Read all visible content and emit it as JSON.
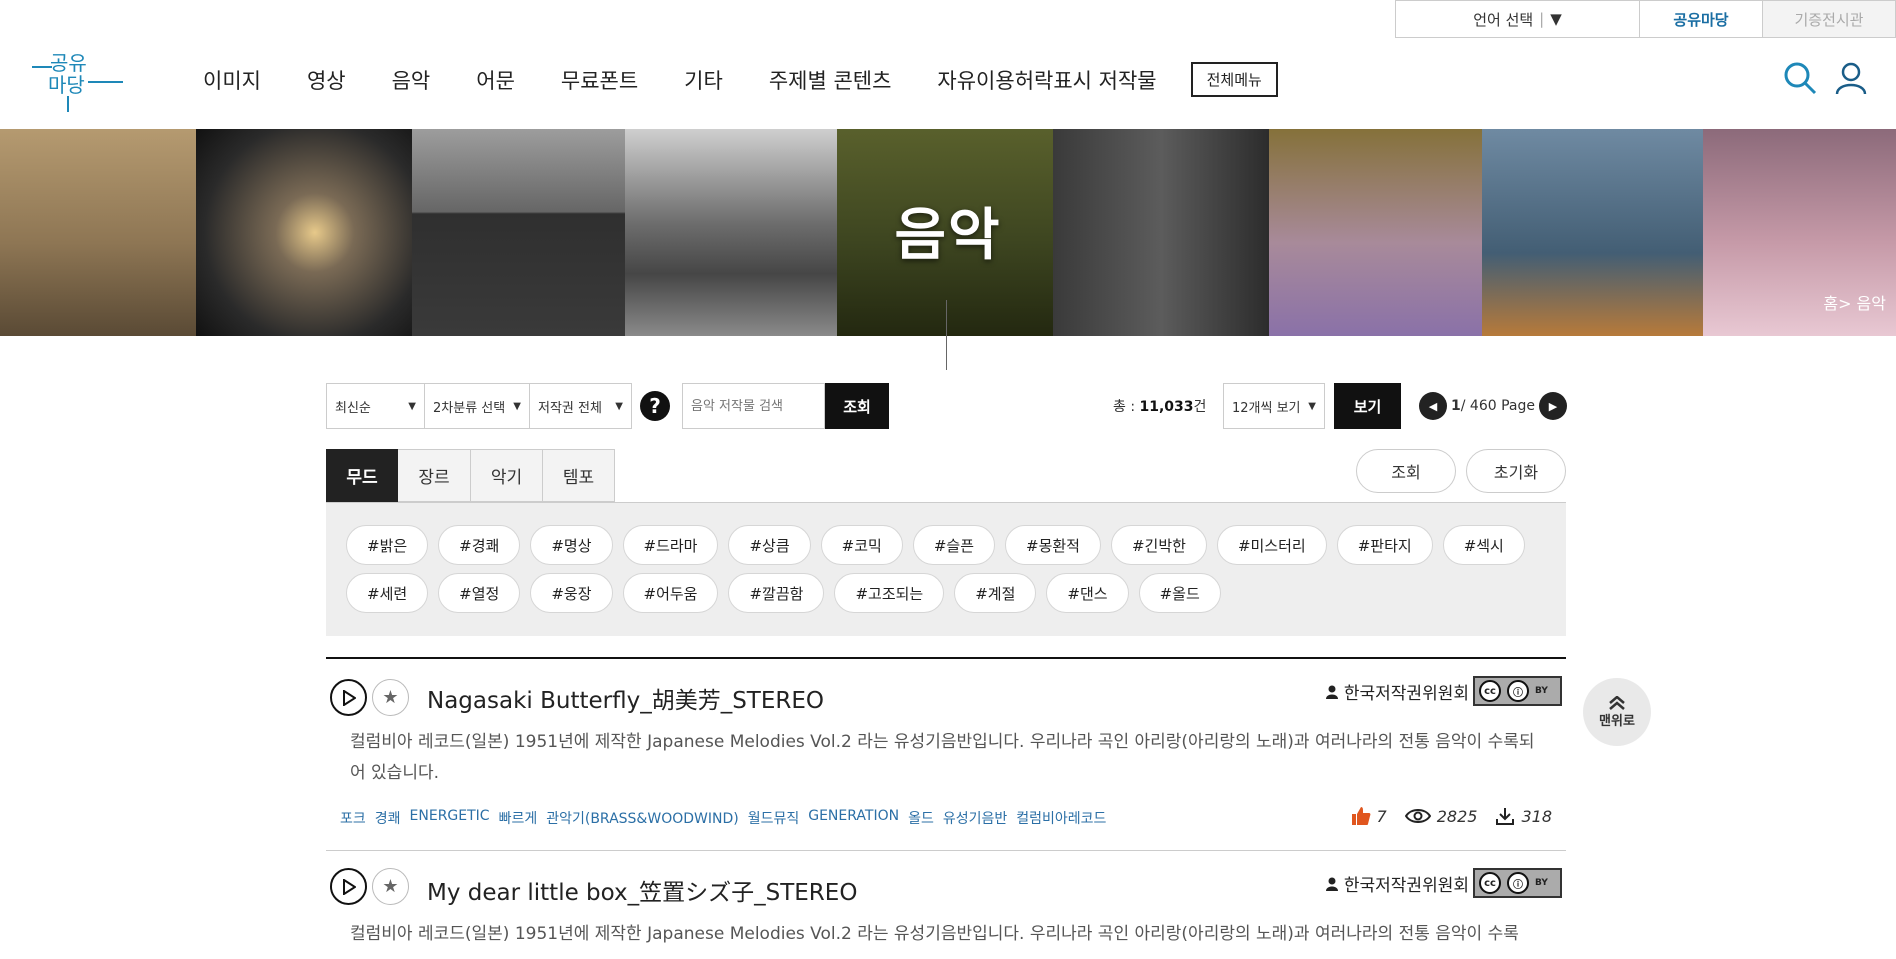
{
  "topbar": {
    "lang": "언어 선택",
    "lang_arrow": "▼",
    "shared": "공유마당",
    "donated": "기증전시관"
  },
  "logo": {
    "line1": "공유",
    "line2": "마당"
  },
  "nav": [
    "이미지",
    "영상",
    "음악",
    "어문",
    "무료폰트",
    "기타",
    "주제별 콘텐츠",
    "자유이용허락표시 저작물"
  ],
  "nav_allmenu": "전체메뉴",
  "banner": {
    "title": "음악",
    "breadcrumb": "홈> 음악"
  },
  "filters": {
    "sort": "최신순",
    "category2": "2차분류 선택",
    "license": "저작권 전체",
    "help": "?",
    "search_placeholder": "음악 저작물 검색",
    "search_btn": "조회",
    "total_label": "총 : ",
    "total_count": "11,033",
    "total_unit": "건",
    "per_page": "12개씩 보기",
    "view_btn": "보기",
    "page_current": "1",
    "page_total": " / 460 Page"
  },
  "tabs": [
    "무드",
    "장르",
    "악기",
    "템포"
  ],
  "tab_actions": {
    "search": "조회",
    "reset": "초기화"
  },
  "mood_tags": [
    "#밝은",
    "#경쾌",
    "#명상",
    "#드라마",
    "#상큼",
    "#코믹",
    "#슬픈",
    "#몽환적",
    "#긴박한",
    "#미스터리",
    "#판타지",
    "#섹시",
    "#세련",
    "#열정",
    "#웅장",
    "#어두움",
    "#깔끔함",
    "#고조되는",
    "#계절",
    "#댄스",
    "#올드"
  ],
  "items": [
    {
      "title": "Nagasaki Butterfly_胡美芳_STEREO",
      "author": "한국저작권위원회",
      "desc": "컬럼비아 레코드(일본) 1951년에 제작한 Japanese Melodies Vol.2 라는 유성기음반입니다. 우리나라 곡인 아리랑(아리랑의 노래)과 여러나라의 전통 음악이 수록되어 있습니다.",
      "keywords": [
        "포크",
        "경쾌",
        "ENERGETIC",
        "빠르게",
        "관악기(BRASS&WOODWIND)",
        "월드뮤직",
        "GENERATION",
        "올드",
        "유성기음반",
        "컬럼비아레코드"
      ],
      "likes": "7",
      "views": "2825",
      "downloads": "318"
    },
    {
      "title": "My dear little box_笠置シズ子_STEREO",
      "author": "한국저작권위원회",
      "desc": "컬럼비아 레코드(일본) 1951년에 제작한 Japanese Melodies Vol.2 라는 유성기음반입니다. 우리나라 곡인 아리랑(아리랑의 노래)과 여러나라의 전통 음악이 수록"
    }
  ],
  "to_top": "맨위로",
  "cc_badge": "BY",
  "colors": {
    "accent": "#1a6ea3",
    "like": "#e0561e",
    "keyword": "#2b6fa6"
  }
}
